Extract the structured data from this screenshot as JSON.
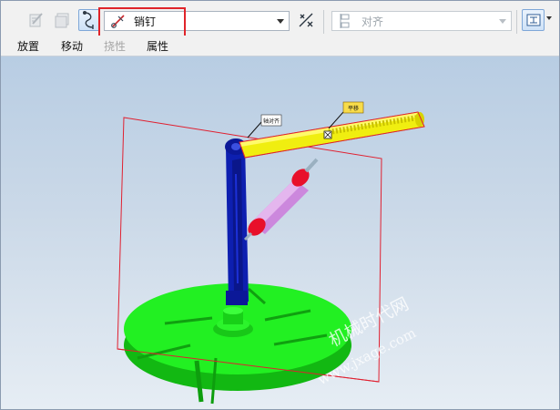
{
  "toolbar": {
    "constraint_combo_value": "销钉",
    "alignment_combo_value": "对齐"
  },
  "tabs": [
    {
      "label": "放置",
      "enabled": true
    },
    {
      "label": "移动",
      "enabled": true
    },
    {
      "label": "挠性",
      "enabled": false
    },
    {
      "label": "属性",
      "enabled": true
    }
  ],
  "viewport": {
    "callouts": {
      "left_tag": "轴对齐",
      "right_tag": "平移"
    },
    "watermark": {
      "line1": "机械时代网",
      "line2": "www.jxage.com"
    }
  },
  "colors": {
    "highlight": "#e0242a",
    "base_plate": "#22f022",
    "column": "#0d1fb0",
    "arm": "#f0ee10",
    "cylinder_body": "#cc88dd",
    "cylinder_cap": "#e8102a",
    "bounding_box": "#e02030"
  }
}
